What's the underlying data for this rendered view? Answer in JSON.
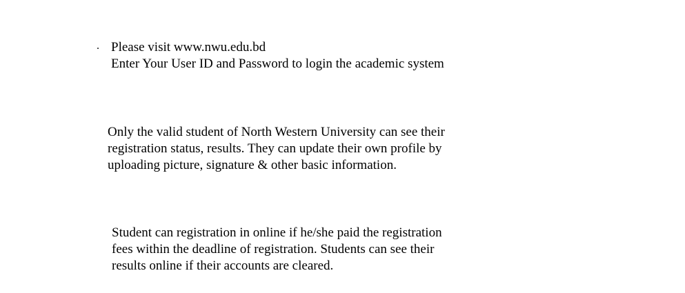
{
  "header": {
    "bullet": ".",
    "visit_text": "Please visit www.nwu.edu.bd",
    "login_text": "Enter Your User ID and Password to login the academic system"
  },
  "info_paragraph": {
    "lines": [
      "Only the valid student of North Western University can see their",
      "registration status, results. They can update their own profile by",
      "uploading picture, signature & other basic information."
    ]
  },
  "registration_paragraph": {
    "lines": [
      "Student can registration in online if he/she paid the registration",
      "fees within the deadline of registration. Students can see their",
      "results online if their accounts are cleared."
    ]
  }
}
